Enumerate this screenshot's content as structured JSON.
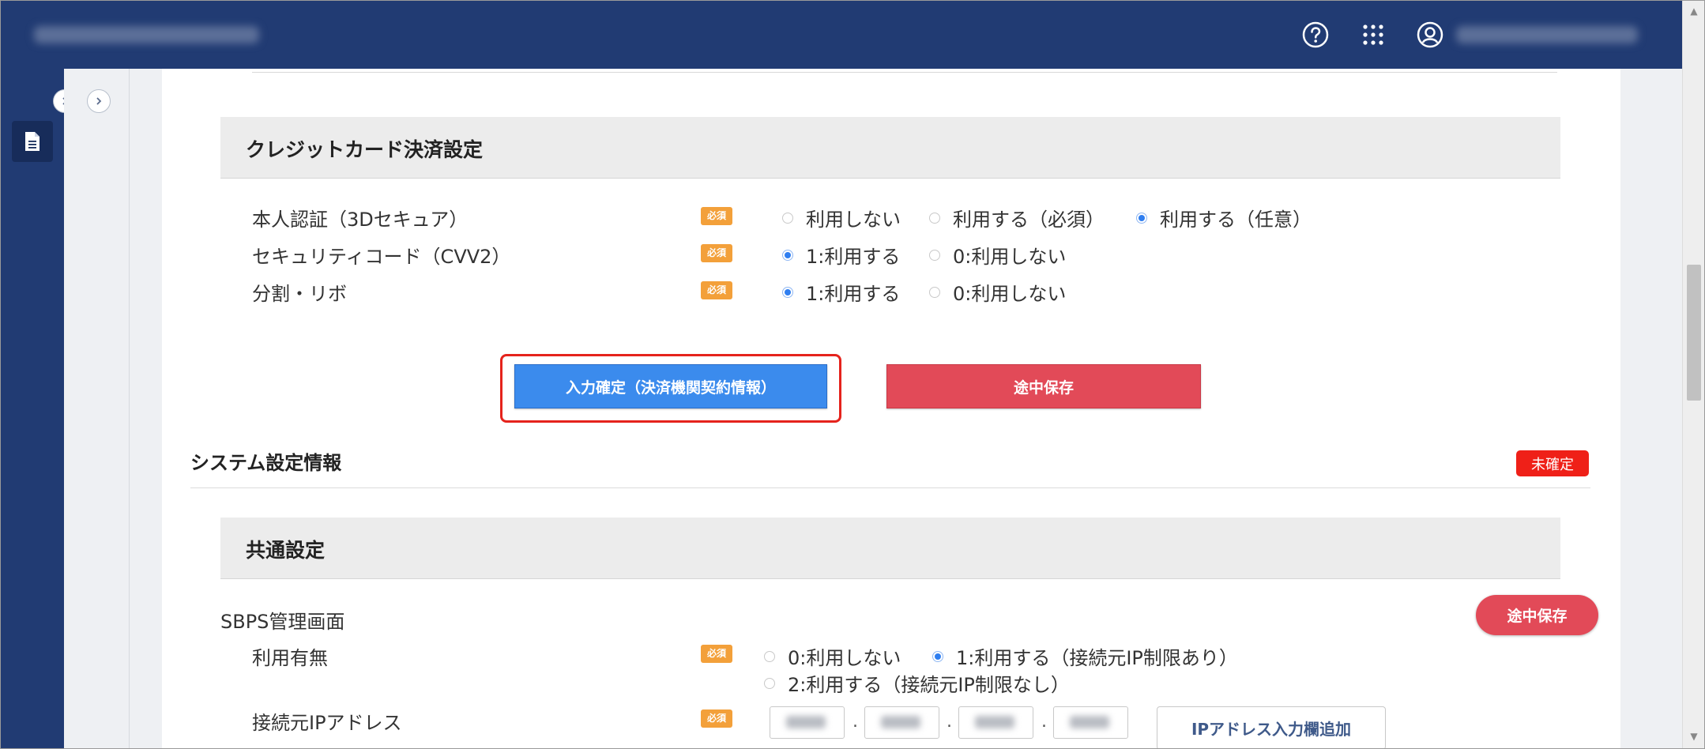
{
  "header": {
    "help_icon": "help-circle-icon",
    "apps_icon": "apps-grid-icon",
    "user_icon": "user-icon"
  },
  "credit_section": {
    "title": "クレジットカード決済設定",
    "rows": [
      {
        "label": "本人認証（3Dセキュア）",
        "required": "必須",
        "options": [
          "利用しない",
          "利用する（必須）",
          "利用する（任意）"
        ],
        "selected": 2
      },
      {
        "label": "セキュリティコード（CVV2）",
        "required": "必須",
        "options": [
          "1:利用する",
          "0:利用しない"
        ],
        "selected": 0
      },
      {
        "label": "分割・リボ",
        "required": "必須",
        "options": [
          "1:利用する",
          "0:利用しない"
        ],
        "selected": 0
      }
    ]
  },
  "actions": {
    "confirm_label": "入力確定（決済機関契約情報）",
    "save_label": "途中保存"
  },
  "system_section": {
    "title": "システム設定情報",
    "status_badge": "未確定"
  },
  "common_section": {
    "title": "共通設定",
    "sbps_label": "SBPS管理画面",
    "save_pill_label": "途中保存",
    "usage": {
      "label": "利用有無",
      "required": "必須",
      "options": [
        "0:利用しない",
        "1:利用する（接続元IP制限あり）",
        "2:利用する（接続元IP制限なし）"
      ],
      "selected": 1
    },
    "ip": {
      "label": "接続元IPアドレス",
      "required": "必須",
      "separator": ".",
      "add_button_label": "IPアドレス入力欄追加"
    }
  }
}
